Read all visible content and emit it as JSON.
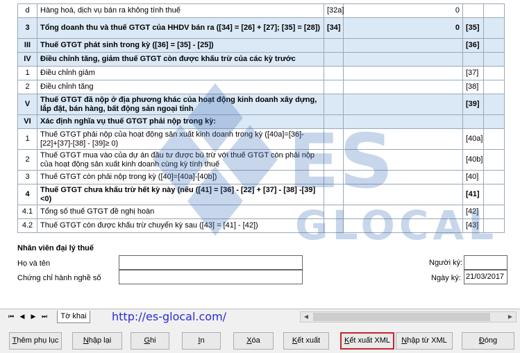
{
  "rows": [
    {
      "stt": "d",
      "label": "Hàng hoá, dịch vụ bán ra không tính thuế",
      "code": "[32a]",
      "value": "0",
      "code2": "",
      "style": "normal"
    },
    {
      "stt": "3",
      "label": "Tổng doanh thu và thuế GTGT của HHDV bán  ra ([34] = [26] + [27]; [35] = [28])",
      "code": "[34]",
      "value": "0",
      "code2": "[35]",
      "style": "bold-blue"
    },
    {
      "stt": "III",
      "label": "Thuế GTGT phát sinh trong kỳ ([36] = [35] - [25])",
      "code": "",
      "value": "",
      "code2": "[36]",
      "style": "bold-blue"
    },
    {
      "stt": "IV",
      "label": "Điều chỉnh tăng, giảm thuế GTGT còn được khấu trừ của các kỳ trước",
      "code": "",
      "value": "",
      "code2": "",
      "style": "bold-blue"
    },
    {
      "stt": "1",
      "label": "Điều chỉnh giảm",
      "code": "",
      "value": "",
      "code2": "[37]",
      "style": "normal"
    },
    {
      "stt": "2",
      "label": "Điều chỉnh tăng",
      "code": "",
      "value": "",
      "code2": "[38]",
      "style": "normal"
    },
    {
      "stt": "V",
      "label": "Thuế GTGT đã nộp ở địa phương khác của hoạt động kinh doanh xây dựng, lắp đặt, bán hàng, bất động sản ngoại tỉnh",
      "code": "",
      "value": "",
      "code2": "[39]",
      "style": "bold-blue"
    },
    {
      "stt": "VI",
      "label": "Xác định nghĩa vụ thuế GTGT phải nộp trong kỳ:",
      "code": "",
      "value": "",
      "code2": "",
      "style": "bold-blue"
    },
    {
      "stt": "1",
      "label": "Thuế GTGT phải nộp của hoạt động sản xuất kinh doanh trong kỳ ([40a]=[36]-[22]+[37]-[38] - [39]≥ 0)",
      "code": "",
      "value": "",
      "code2": "[40a]",
      "style": "normal"
    },
    {
      "stt": "2",
      "label": "Thuế GTGT mua vào của dự án đầu tư được bù trừ với thuế GTGT còn phải nộp của hoạt động sản xuất kinh doanh cùng kỳ tính thuế",
      "code": "",
      "value": "",
      "code2": "[40b]",
      "style": "normal"
    },
    {
      "stt": "3",
      "label": "Thuế GTGT còn phải nộp trong kỳ ([40]=[40a]-[40b])",
      "code": "",
      "value": "",
      "code2": "[40]",
      "style": "normal"
    },
    {
      "stt": "4",
      "label": "Thuế GTGT chưa khấu trừ hết kỳ này (nếu ([41] = [36] - [22] + [37] - [38] -[39] <0)",
      "code": "",
      "value": "",
      "code2": "[41]",
      "style": "bold"
    },
    {
      "stt": "4.1",
      "label": "Tổng số thuế GTGT đề nghị hoàn",
      "code": "",
      "value": "",
      "code2": "[42]",
      "style": "normal"
    },
    {
      "stt": "4.2",
      "label": "Thuế GTGT còn được khấu trừ chuyển kỳ sau ([43] = [41] - [42])",
      "code": "",
      "value": "",
      "code2": "[43]",
      "style": "normal"
    }
  ],
  "agent": {
    "title": "Nhân viên đại lý thuế",
    "name_label": "Họ và tên",
    "cert_label": "Chứng chỉ hành nghề số",
    "signer_label": "Người ký:",
    "date_label": "Ngày ký:",
    "date_value": "21/03/2017"
  },
  "tabs": {
    "sheet_tab": "Tờ khai",
    "link_text": "http://es-glocal.com/"
  },
  "buttons": [
    {
      "label": "Thêm phụ lục",
      "u": "T"
    },
    {
      "label": "Nhập lại",
      "u": "N"
    },
    {
      "label": "Ghi",
      "u": "G"
    },
    {
      "label": "In",
      "u": "I"
    },
    {
      "label": "Xóa",
      "u": "X"
    },
    {
      "label": "Kết xuất",
      "u": "K"
    },
    {
      "label": "Kết xuất XML",
      "u": "K"
    },
    {
      "label": "Nhập từ XML",
      "u": "N"
    },
    {
      "label": "Đóng",
      "u": "Đ"
    }
  ],
  "selected_button": "Kết xuất XML",
  "watermark_text": "ES GLOCAL",
  "colors": {
    "row_highlight": "#dbe9f7",
    "link": "#2a2ad6",
    "selected_border": "#c0272d"
  }
}
